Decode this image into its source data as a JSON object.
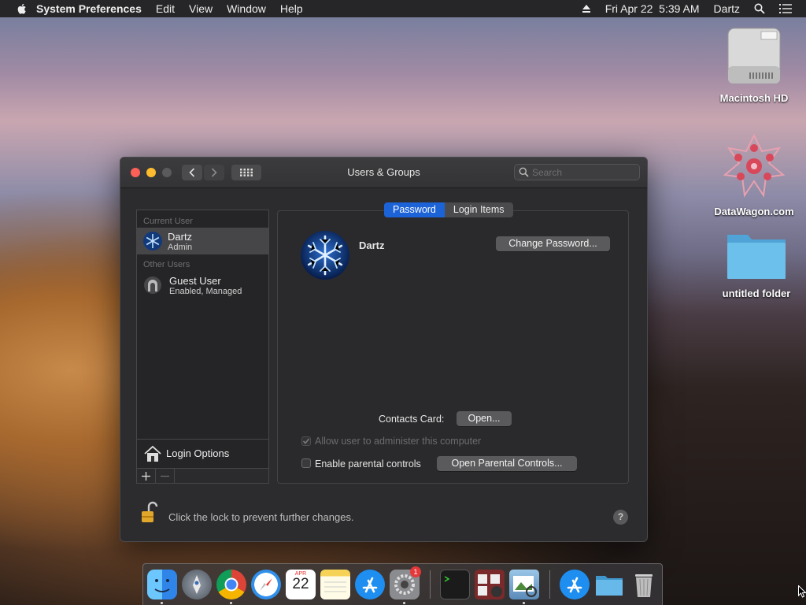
{
  "menubar": {
    "app_name": "System Preferences",
    "menus": [
      "Edit",
      "View",
      "Window",
      "Help"
    ],
    "datetime": "Fri Apr 22  5:39 AM",
    "user": "Dartz"
  },
  "desktop": {
    "icons": [
      {
        "label": "Macintosh HD",
        "icon": "hard-drive-icon"
      },
      {
        "label": "DataWagon.com",
        "icon": "datawagon-logo-icon"
      },
      {
        "label": "untitled folder",
        "icon": "folder-icon"
      }
    ]
  },
  "window": {
    "title": "Users & Groups",
    "search_placeholder": "Search"
  },
  "sidebar": {
    "current_user_header": "Current User",
    "current_user": {
      "name": "Dartz",
      "role": "Admin"
    },
    "other_users_header": "Other Users",
    "other_users": [
      {
        "name": "Guest User",
        "role": "Enabled, Managed"
      }
    ],
    "login_options_label": "Login Options"
  },
  "detail": {
    "tabs": [
      {
        "label": "Password",
        "active": true
      },
      {
        "label": "Login Items",
        "active": false
      }
    ],
    "user_name": "Dartz",
    "change_password_label": "Change Password...",
    "contacts_card_label": "Contacts Card:",
    "open_label": "Open...",
    "allow_admin_label": "Allow user to administer this computer",
    "allow_admin_checked": true,
    "allow_admin_enabled": false,
    "parental_controls_label": "Enable parental controls",
    "parental_controls_checked": false,
    "open_parental_controls_label": "Open Parental Controls..."
  },
  "footer": {
    "lock_text": "Click the lock to prevent further changes.",
    "help_label": "?"
  },
  "dock": {
    "calendar_month": "APR",
    "calendar_day": "22",
    "system_prefs_badge": "1",
    "apps": [
      "Finder",
      "Launchpad",
      "Google Chrome",
      "Safari",
      "Calendar",
      "Notes",
      "App Store",
      "System Preferences",
      "Terminal",
      "Photo Booth",
      "Preview",
      "App Store",
      "Downloads",
      "Trash"
    ]
  },
  "colors": {
    "accent": "#1c63d8",
    "close": "#fe5f57",
    "minimize": "#febc2e",
    "window_bg": "#2c2c2e"
  }
}
